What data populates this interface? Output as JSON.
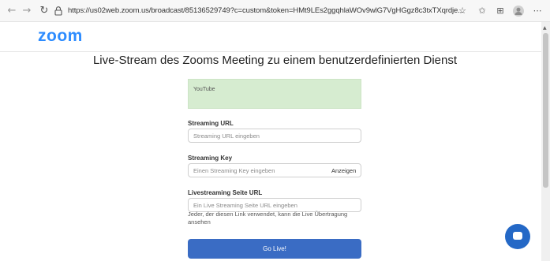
{
  "browser": {
    "back_icon": "←",
    "forward_icon": "→",
    "reload_icon": "↻",
    "url": "https://us02web.zoom.us/broadcast/85136529749?c=custom&token=HMt9LEs2ggqhlaWOv9wlG7VgHGgz8c3txTXqrdje...",
    "toolbar_icons": [
      "star-icon",
      "favorites-icon",
      "collections-icon",
      "profile-icon",
      "more-icon"
    ],
    "star_glyph": "☆",
    "favorites_glyph": "✩",
    "collections_glyph": "⊞",
    "more_glyph": "⋯"
  },
  "header": {
    "logo": "zoom",
    "logo_color": "#2d8cff"
  },
  "main": {
    "title": "Live-Stream des Zooms Meeting zu einem benutzerdefinierten Dienst",
    "service": {
      "label": "YouTube",
      "bg_color": "#d6ecd0"
    },
    "streaming_url": {
      "label": "Streaming URL",
      "placeholder": "Streaming URL eingeben",
      "value": ""
    },
    "streaming_key": {
      "label": "Streaming Key",
      "placeholder": "Einen Streaming Key eingeben",
      "value": "",
      "show_label": "Anzeigen"
    },
    "page_url": {
      "label": "Livestreaming Seite URL",
      "placeholder": "Ein Live Streaming Seite URL eingeben",
      "value": "",
      "help": "Jeder, der diesen Link verwendet, kann die Live Übertragung ansehen"
    },
    "go_live_label": "Go Live!",
    "go_live_color": "#3a6cc4"
  },
  "chat_fab": {
    "icon": "chat-icon",
    "color": "#2468c6"
  }
}
